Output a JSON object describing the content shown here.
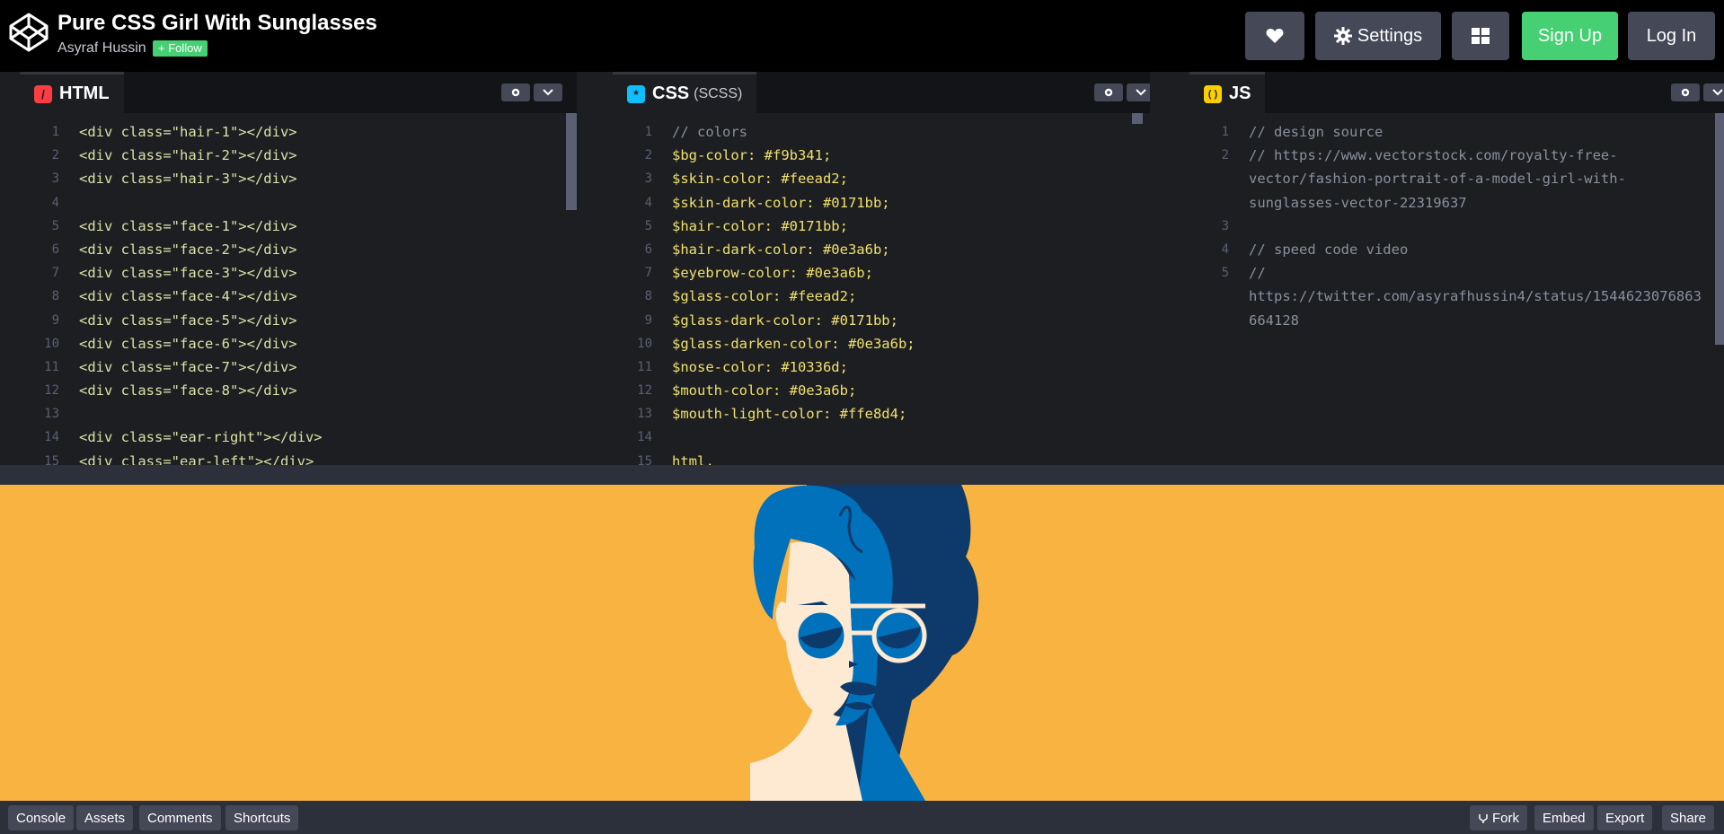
{
  "header": {
    "title": "Pure CSS Girl With Sunglasses",
    "author": "Asyraf Hussin",
    "follow_label": "+ Follow",
    "settings_label": "Settings",
    "signup_label": "Sign Up",
    "login_label": "Log In"
  },
  "editors": {
    "html": {
      "label": "HTML",
      "lines": [
        {
          "n": "1",
          "code": "<div class=\"hair-1\"></div>"
        },
        {
          "n": "2",
          "code": "<div class=\"hair-2\"></div>"
        },
        {
          "n": "3",
          "code": "<div class=\"hair-3\"></div>"
        },
        {
          "n": "4",
          "code": ""
        },
        {
          "n": "5",
          "code": "<div class=\"face-1\"></div>"
        },
        {
          "n": "6",
          "code": "<div class=\"face-2\"></div>"
        },
        {
          "n": "7",
          "code": "<div class=\"face-3\"></div>"
        },
        {
          "n": "8",
          "code": "<div class=\"face-4\"></div>"
        },
        {
          "n": "9",
          "code": "<div class=\"face-5\"></div>"
        },
        {
          "n": "10",
          "code": "<div class=\"face-6\"></div>"
        },
        {
          "n": "11",
          "code": "<div class=\"face-7\"></div>"
        },
        {
          "n": "12",
          "code": "<div class=\"face-8\"></div>"
        },
        {
          "n": "13",
          "code": ""
        },
        {
          "n": "14",
          "code": "<div class=\"ear-right\"></div>"
        },
        {
          "n": "15",
          "code": "<div class=\"ear-left\"></div>"
        }
      ]
    },
    "css": {
      "label": "CSS",
      "sublabel": "(SCSS)",
      "lines": [
        {
          "n": "1",
          "code": "// colors"
        },
        {
          "n": "2",
          "code": "$bg-color: #f9b341;"
        },
        {
          "n": "3",
          "code": "$skin-color: #feead2;"
        },
        {
          "n": "4",
          "code": "$skin-dark-color: #0171bb;"
        },
        {
          "n": "5",
          "code": "$hair-color: #0171bb;"
        },
        {
          "n": "6",
          "code": "$hair-dark-color: #0e3a6b;"
        },
        {
          "n": "7",
          "code": "$eyebrow-color: #0e3a6b;"
        },
        {
          "n": "8",
          "code": "$glass-color: #feead2;"
        },
        {
          "n": "9",
          "code": "$glass-dark-color: #0171bb;"
        },
        {
          "n": "10",
          "code": "$glass-darken-color: #0e3a6b;"
        },
        {
          "n": "11",
          "code": "$nose-color: #10336d;"
        },
        {
          "n": "12",
          "code": "$mouth-color: #0e3a6b;"
        },
        {
          "n": "13",
          "code": "$mouth-light-color: #ffe8d4;"
        },
        {
          "n": "14",
          "code": ""
        },
        {
          "n": "15",
          "code": "html,"
        }
      ]
    },
    "js": {
      "label": "JS",
      "lines": [
        {
          "n": "1",
          "code": "// design source"
        },
        {
          "n": "2",
          "code": "// https://www.vectorstock.com/royalty-free-"
        },
        {
          "n": "",
          "code": "vector/fashion-portrait-of-a-model-girl-with-"
        },
        {
          "n": "",
          "code": "sunglasses-vector-22319637"
        },
        {
          "n": "3",
          "code": ""
        },
        {
          "n": "4",
          "code": "// speed code video"
        },
        {
          "n": "5",
          "code": "//"
        },
        {
          "n": "",
          "code": "https://twitter.com/asyrafhussin4/status/1544623076863"
        },
        {
          "n": "",
          "code": "664128"
        }
      ]
    }
  },
  "bottombar": {
    "console": "Console",
    "assets": "Assets",
    "comments": "Comments",
    "shortcuts": "Shortcuts",
    "fork": "Fork",
    "embed": "Embed",
    "export": "Export",
    "share": "Share"
  },
  "colors": {
    "bg": "#f9b341",
    "skin": "#feead2",
    "hair": "#0171bb",
    "hair_dark": "#0e3a6b"
  }
}
